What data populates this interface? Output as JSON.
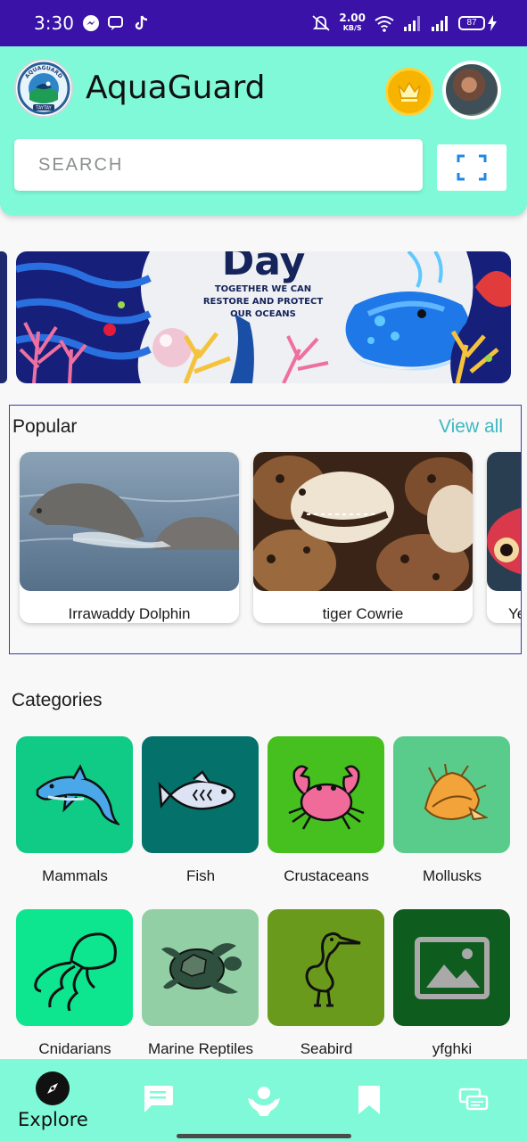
{
  "status_bar": {
    "time": "3:30",
    "net_speed": "2.00",
    "net_unit": "KB/S",
    "battery": "87",
    "icons": [
      "messenger-icon",
      "chat-icon",
      "tiktok-icon",
      "mute-icon",
      "wifi-icon",
      "signal-icon",
      "signal-icon",
      "battery-icon",
      "charging-icon"
    ]
  },
  "header": {
    "logo_text_top": "AQUAGUARD",
    "logo_text_bottom": "TAYTAY",
    "title": "AquaGuard",
    "search_placeholder": "SEARCH",
    "coin_icon": "crown-coin-icon",
    "scan_icon": "scan-frame-icon"
  },
  "banner": {
    "title": "Day",
    "subtitle": "TOGETHER WE CAN RESTORE AND PROTECT OUR OCEANS"
  },
  "popular": {
    "title": "Popular",
    "view_all": "View all",
    "items": [
      {
        "label": "Irrawaddy Dolphin"
      },
      {
        "label": "tiger Cowrie"
      },
      {
        "label": "Ye"
      }
    ]
  },
  "categories": {
    "title": "Categories",
    "items": [
      {
        "label": "Mammals",
        "color": "#0fcb85",
        "icon": "dolphin-icon"
      },
      {
        "label": "Fish",
        "color": "#04726b",
        "icon": "fish-icon"
      },
      {
        "label": "Crustaceans",
        "color": "#46c01e",
        "icon": "crab-icon"
      },
      {
        "label": "Mollusks",
        "color": "#59cc8c",
        "icon": "shell-icon"
      },
      {
        "label": "Cnidarians",
        "color": "#0de58f",
        "icon": "jellyfish-icon"
      },
      {
        "label": "Marine Reptiles",
        "color": "#93cfa4",
        "icon": "turtle-icon"
      },
      {
        "label": "Seabird",
        "color": "#6a9a1b",
        "icon": "heron-icon"
      },
      {
        "label": "yfghki",
        "color": "#0e5c1e",
        "icon": "image-placeholder-icon"
      }
    ]
  },
  "bottom_nav": {
    "items": [
      {
        "label": "Explore",
        "icon": "compass-icon",
        "active": true
      },
      {
        "label": "",
        "icon": "chat-bubble-icon",
        "active": false
      },
      {
        "label": "",
        "icon": "helping-hands-icon",
        "active": false
      },
      {
        "label": "",
        "icon": "bookmark-icon",
        "active": false
      },
      {
        "label": "",
        "icon": "messages-icon",
        "active": false
      }
    ]
  }
}
